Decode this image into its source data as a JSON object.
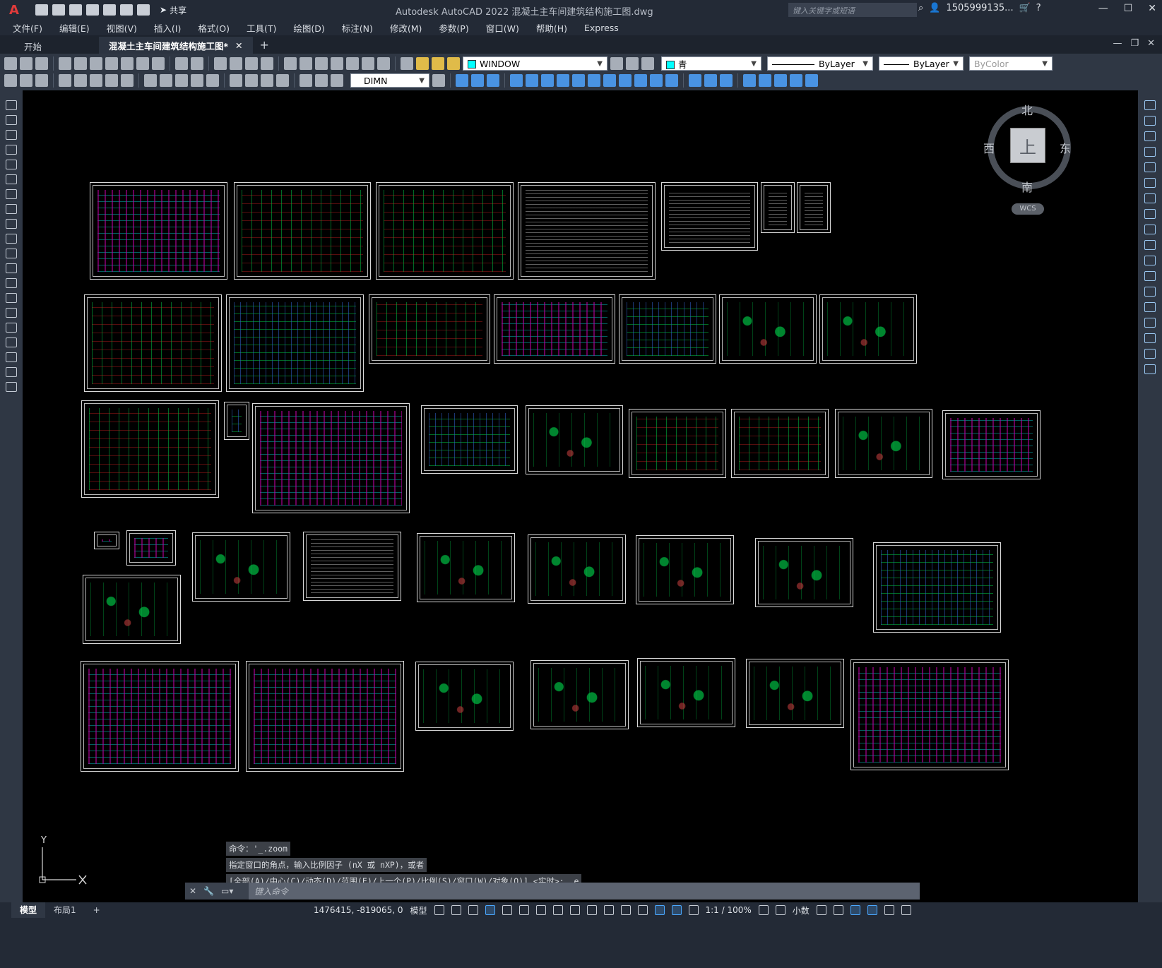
{
  "app": {
    "title": "Autodesk AutoCAD 2022    混凝土主车间建筑结构施工图.dwg",
    "logo": "A",
    "share_label": "共享",
    "search_placeholder": "键入关键字或短语",
    "user": "1505999135...",
    "window_controls": [
      "—",
      "☐",
      "✕"
    ]
  },
  "menu": [
    "文件(F)",
    "编辑(E)",
    "视图(V)",
    "插入(I)",
    "格式(O)",
    "工具(T)",
    "绘图(D)",
    "标注(N)",
    "修改(M)",
    "参数(P)",
    "窗口(W)",
    "帮助(H)",
    "Express"
  ],
  "tabs": [
    {
      "label": "开始"
    },
    {
      "label": "混凝土主车间建筑结构施工图*"
    }
  ],
  "toolbar": {
    "layer": "WINDOW",
    "color": "青",
    "linetype": "ByLayer",
    "lineweight": "ByLayer",
    "plotstyle": "ByColor",
    "dimstyle": "DIMN"
  },
  "viewcube": {
    "face": "上",
    "north": "北",
    "south": "南",
    "east": "东",
    "west": "西",
    "coord_system": "WCS"
  },
  "ucs": {
    "y": "Y"
  },
  "command": {
    "history": [
      "命令：'_.zoom",
      "指定窗口的角点，输入比例因子 (nX 或 nXP)，或者",
      "[全部(A)/中心(C)/动态(D)/范围(E)/上一个(P)/比例(S)/窗口(W)/对象(O)] <实时>: _e"
    ],
    "placeholder": "键入命令"
  },
  "layout_tabs": [
    "模型",
    "布局1"
  ],
  "status": {
    "coords": "1476415, -819065, 0",
    "space": "模型",
    "scale": "1:1 / 100%",
    "units": "小数"
  }
}
